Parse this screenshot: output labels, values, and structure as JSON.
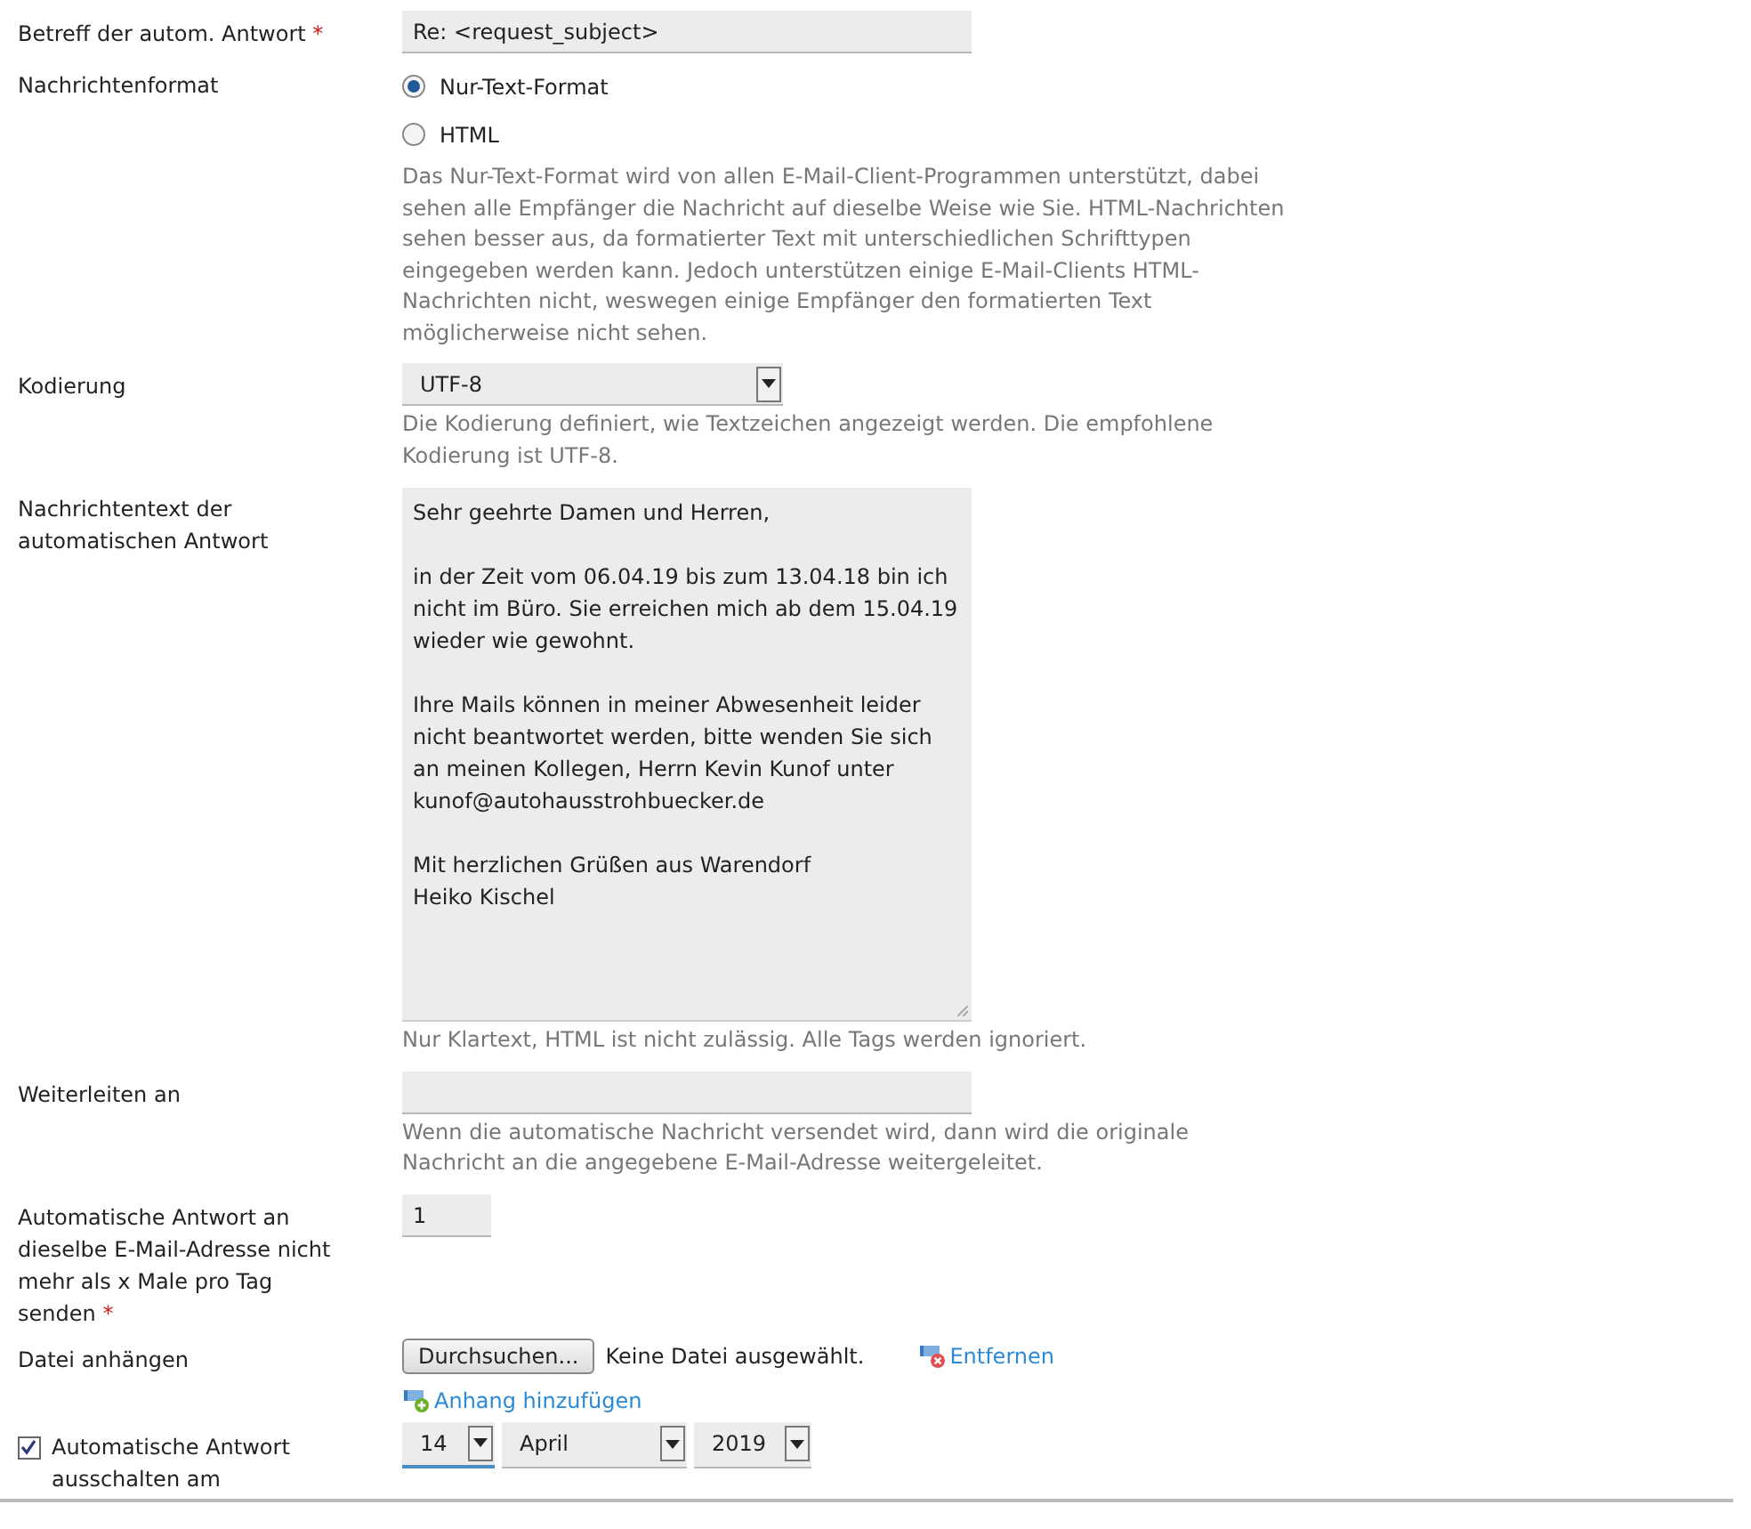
{
  "subject": {
    "label": "Betreff der autom. Antwort",
    "required_mark": "*",
    "value": "Re: <request_subject>"
  },
  "format": {
    "label": "Nachrichtenformat",
    "options": [
      {
        "label": "Nur-Text-Format",
        "selected": true
      },
      {
        "label": "HTML",
        "selected": false
      }
    ],
    "hint": "Das Nur-Text-Format wird von allen E-Mail-Client-Programmen unterstützt, dabei sehen alle Empfänger die Nachricht auf dieselbe Weise wie Sie. HTML-Nachrichten sehen besser aus, da formatierter Text mit unterschiedlichen Schrifttypen eingegeben werden kann. Jedoch unterstützen einige E-Mail-Clients HTML-Nachrichten nicht, weswegen einige Empfänger den formatierten Text möglicherweise nicht sehen."
  },
  "encoding": {
    "label": "Kodierung",
    "value": "UTF-8",
    "hint": "Die Kodierung definiert, wie Textzeichen angezeigt werden. Die empfohlene Kodierung ist UTF-8."
  },
  "message": {
    "label": "Nachrichtentext der automatischen Antwort",
    "value": "Sehr geehrte Damen und Herren,\n\nin der Zeit vom 06.04.19 bis zum 13.04.18 bin ich nicht im Büro. Sie erreichen mich ab dem 15.04.19 wieder wie gewohnt.\n\nIhre Mails können in meiner Abwesenheit leider nicht beantwortet werden, bitte wenden Sie sich an meinen Kollegen, Herrn Kevin Kunof unter kunof@autohausstrohbuecker.de\n\nMit herzlichen Grüßen aus Warendorf\nHeiko Kischel",
    "hint": "Nur Klartext, HTML ist nicht zulässig. Alle Tags werden ignoriert."
  },
  "forward": {
    "label": "Weiterleiten an",
    "hint": "Wenn die automatische Nachricht versendet wird, dann wird die originale Nachricht an die angegebene E-Mail-Adresse weitergeleitet."
  },
  "limit": {
    "label": "Automatische Antwort an dieselbe E-Mail-Adresse nicht mehr als x Male pro Tag senden",
    "required_mark": "*",
    "value": "1"
  },
  "attachment": {
    "label": "Datei anhängen",
    "browse": "Durchsuchen...",
    "status": "Keine Datei ausgewählt.",
    "remove": "Entfernen",
    "add": "Anhang hinzufügen"
  },
  "disable": {
    "label": "Automatische Antwort ausschalten am",
    "checked": true,
    "day": "14",
    "month": "April",
    "year": "2019"
  }
}
